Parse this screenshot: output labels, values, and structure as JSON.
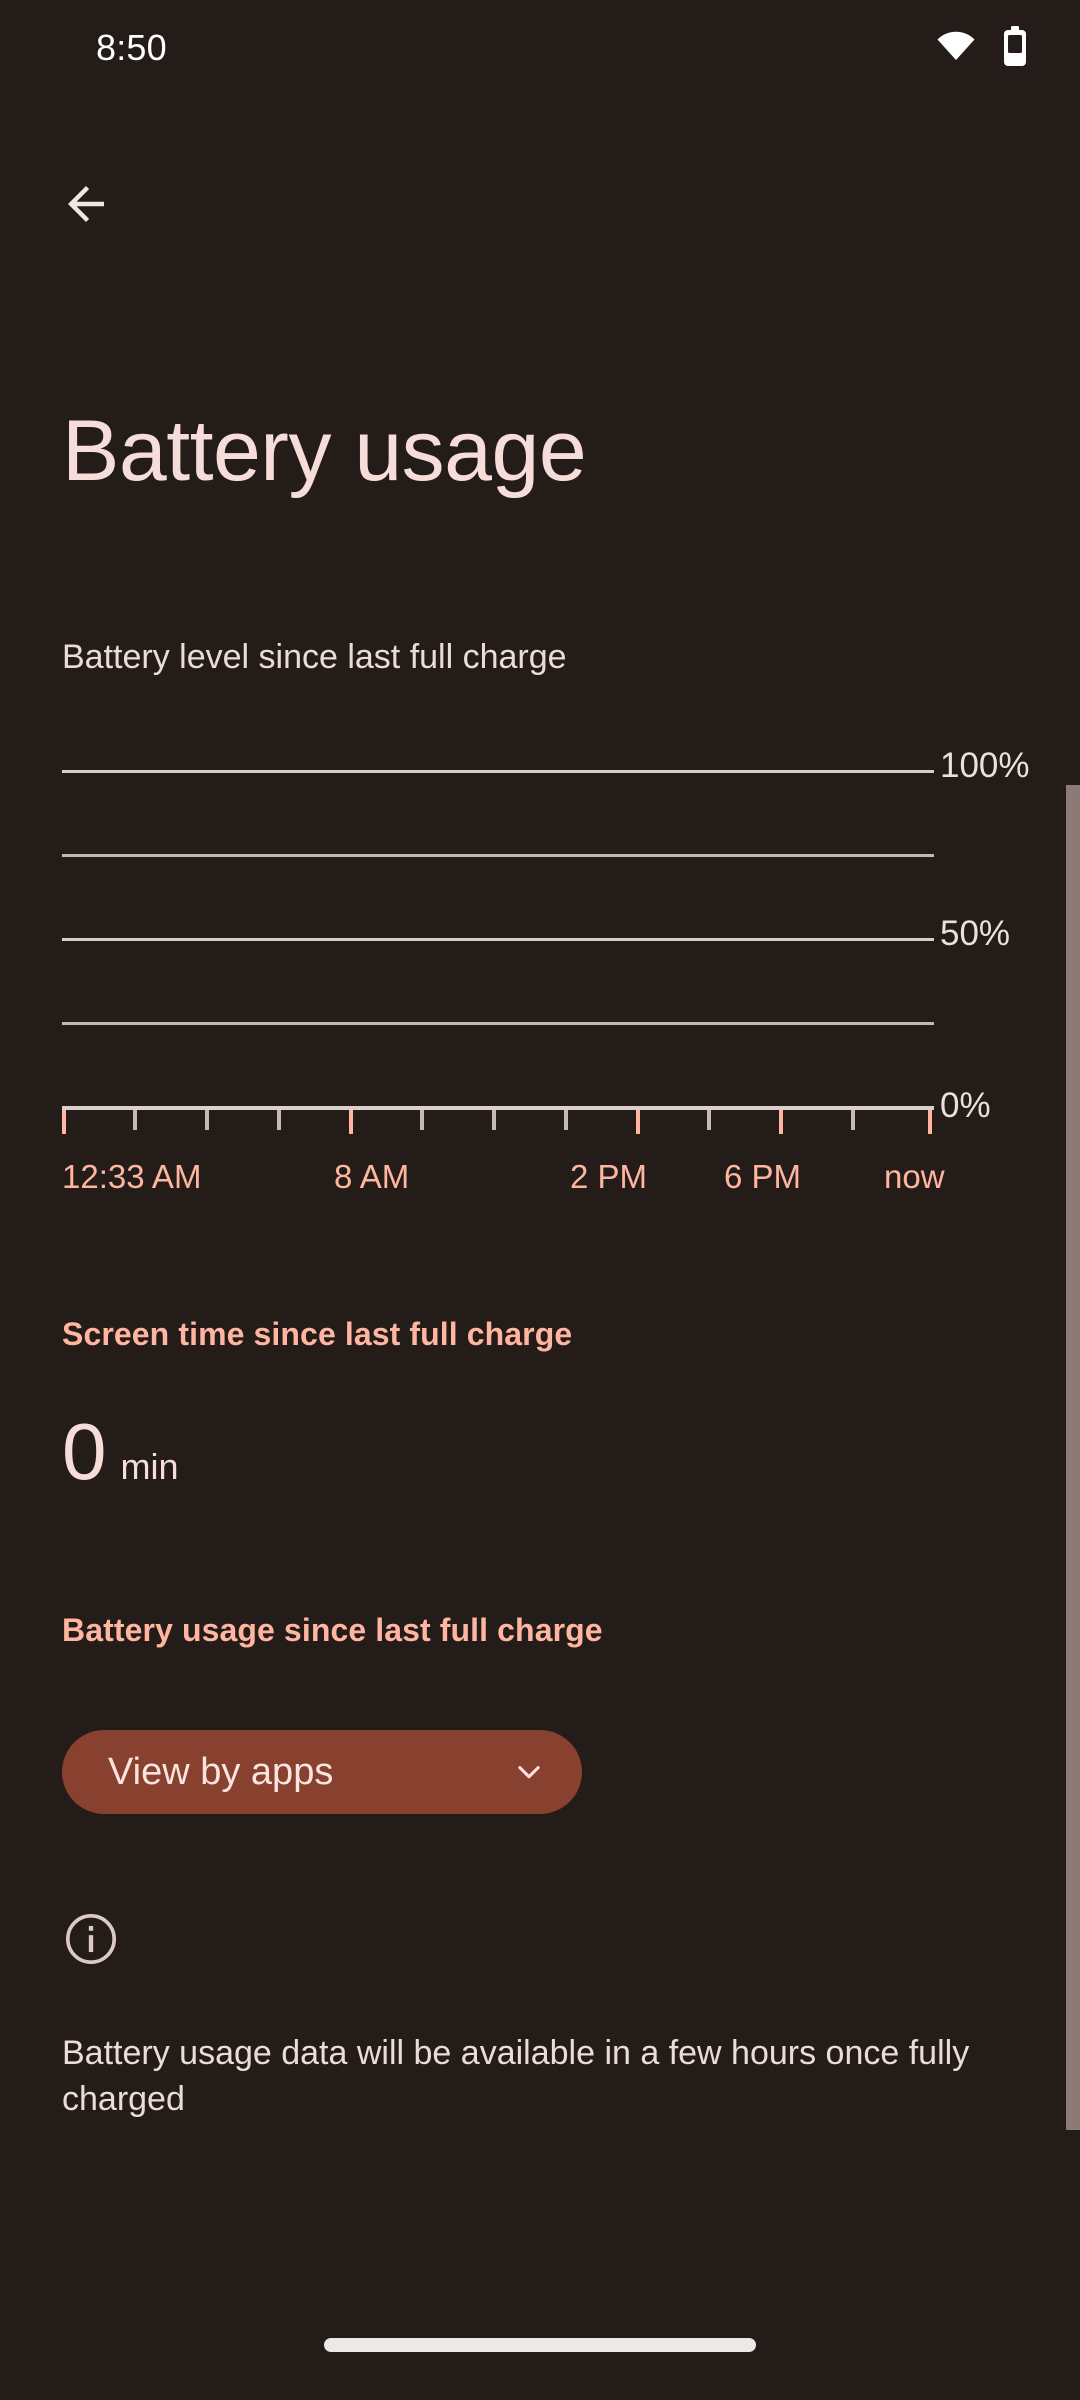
{
  "status_bar": {
    "clock": "8:50",
    "wifi_icon": "wifi-icon",
    "battery_icon": "battery-icon"
  },
  "nav": {
    "back_icon": "arrow-back-icon"
  },
  "header": {
    "title": "Battery usage"
  },
  "chart_section": {
    "caption": "Battery level since last full charge"
  },
  "chart_data": {
    "type": "line",
    "title": "Battery level since last full charge",
    "xlabel": "",
    "ylabel": "",
    "ylim": [
      0,
      100
    ],
    "y_ticks": [
      0,
      25,
      50,
      75,
      100
    ],
    "y_tick_labels": [
      "0%",
      "",
      "50%",
      "",
      "100%"
    ],
    "y_labels_shown": [
      "100%",
      "50%",
      "0%"
    ],
    "grid": true,
    "gridline_count": 4,
    "x_tick_labels": [
      "12:33 AM",
      "8 AM",
      "2 PM",
      "6 PM",
      "now"
    ],
    "x_tick_count": 13,
    "x_major_tick_indices": [
      0,
      4,
      8,
      10,
      12
    ],
    "series": [
      {
        "name": "Battery level",
        "values": []
      }
    ],
    "legend": "none",
    "note": "No battery level data plotted yet"
  },
  "screen_time": {
    "heading": "Screen time since last full charge",
    "value": "0",
    "unit": "min"
  },
  "battery_usage": {
    "heading": "Battery usage since last full charge",
    "view_button_label": "View by apps",
    "view_button_icon": "chevron-down-icon"
  },
  "info": {
    "icon": "info-icon",
    "text": "Battery usage data will be available in a few hours once fully charged"
  },
  "colors": {
    "background": "#241c19",
    "accent": "#ffb5a0",
    "on_surface": "#f6ddd9",
    "button_bg": "#88402f",
    "gridline": "#d9cdc9",
    "scrollbar": "#8d7a77"
  },
  "system_nav": {
    "gesture_pill": "home-gesture-pill"
  }
}
